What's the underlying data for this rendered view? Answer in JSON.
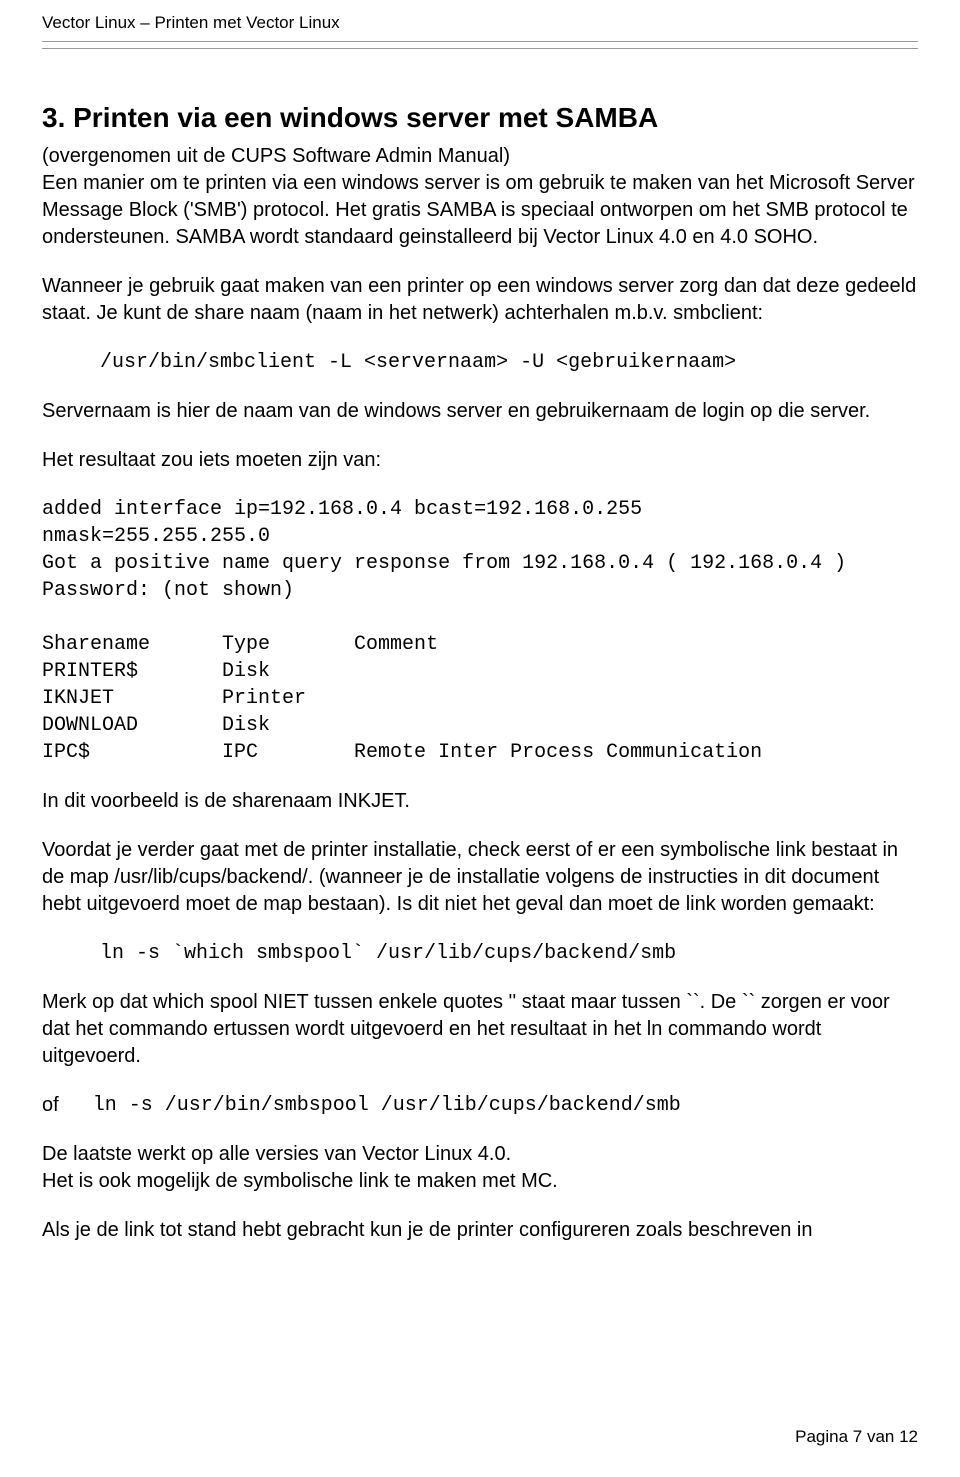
{
  "header": {
    "left": "Vector Linux – Printen met Vector Linux"
  },
  "section": {
    "title": "3. Printen via een windows server met SAMBA",
    "p1": "(overgenomen uit de CUPS Software Admin Manual)\nEen manier om te printen via een windows server is om gebruik te maken van het Microsoft Server Message Block ('SMB') protocol. Het gratis SAMBA is speciaal ontworpen om het SMB protocol te ondersteunen. SAMBA wordt standaard geinstalleerd bij Vector Linux 4.0 en 4.0 SOHO.",
    "p2": "Wanneer je gebruik gaat maken van een printer op een windows server zorg dan dat deze gedeeld staat. Je kunt de share naam (naam in het netwerk) achterhalen m.b.v. smbclient:",
    "cmd1": "/usr/bin/smbclient -L <servernaam> -U <gebruikernaam>",
    "p3": "Servernaam is hier de naam van de windows server en gebruikernaam de login op die server.",
    "p4": "Het resultaat zou iets moeten zijn van:",
    "output": "added interface ip=192.168.0.4 bcast=192.168.0.255\nnmask=255.255.255.0\nGot a positive name query response from 192.168.0.4 ( 192.168.0.4 )\nPassword: (not shown)\n\nSharename      Type       Comment\nPRINTER$       Disk\nIKNJET         Printer\nDOWNLOAD       Disk\nIPC$           IPC        Remote Inter Process Communication",
    "p5": "In dit voorbeeld is de sharenaam INKJET.",
    "p6": "Voordat je verder gaat met de printer installatie, check eerst of er een symbolische link bestaat in de map /usr/lib/cups/backend/. (wanneer je de installatie volgens de instructies in dit document hebt uitgevoerd moet de map bestaan). Is dit niet het geval dan moet de link worden gemaakt:",
    "cmd2": "ln -s `which smbspool` /usr/lib/cups/backend/smb",
    "p7": "Merk op dat which spool NIET tussen enkele quotes '' staat maar tussen ``. De `` zorgen er voor dat het commando ertussen wordt uitgevoerd en het resultaat in het ln commando wordt uitgevoerd.",
    "of_label": "of",
    "cmd3": "ln -s /usr/bin/smbspool /usr/lib/cups/backend/smb",
    "p8": "De laatste werkt op alle versies van Vector Linux 4.0.\nHet is ook mogelijk de symbolische link te maken met MC.",
    "p9": "Als je de link tot stand hebt gebracht kun je de printer configureren zoals beschreven in"
  },
  "footer": {
    "text": "Pagina 7 van 12"
  }
}
